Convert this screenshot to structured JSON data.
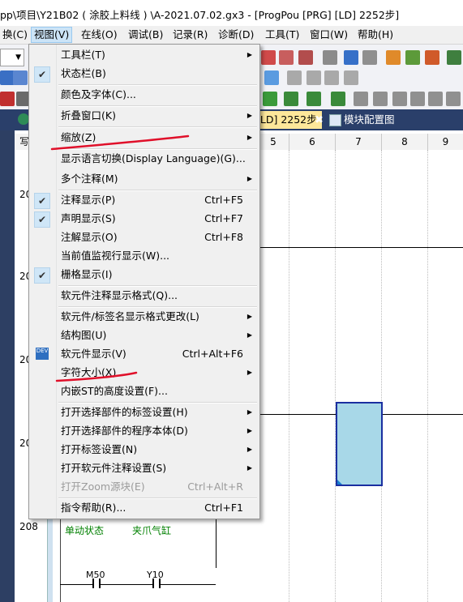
{
  "window": {
    "title": "pp\\项目\\Y21B02 ( 涂胶上料线 ) \\A-2021.07.02.gx3 - [ProgPou [PRG] [LD] 2252步]"
  },
  "menubar": {
    "items": [
      {
        "label": "换(C)"
      },
      {
        "label": "视图(V)"
      },
      {
        "label": "在线(O)"
      },
      {
        "label": "调试(B)"
      },
      {
        "label": "记录(R)"
      },
      {
        "label": "诊断(D)"
      },
      {
        "label": "工具(T)"
      },
      {
        "label": "窗口(W)"
      },
      {
        "label": "帮助(H)"
      }
    ]
  },
  "tabs": [
    {
      "label": "[LD] 2252步"
    },
    {
      "label": "模块配置图"
    }
  ],
  "ladder": {
    "columns": [
      "写",
      "5",
      "6",
      "7",
      "8",
      "9"
    ],
    "row_numbers": [
      "20",
      "20",
      "20",
      "20",
      "208"
    ],
    "comments": {
      "c1": "单动状态",
      "c2": "夹爪气缸"
    },
    "contacts": {
      "m50": "M50",
      "y10": "Y10"
    }
  },
  "dropdown": {
    "items": [
      {
        "label": "工具栏(T)",
        "has_submenu": true
      },
      {
        "label": "状态栏(B)",
        "checked": true
      },
      {
        "label": "颜色及字体(C)..."
      },
      {
        "label": "折叠窗口(K)",
        "has_submenu": true
      },
      {
        "label": "缩放(Z)",
        "has_submenu": true
      },
      {
        "label": "显示语言切换(Display Language)(G)..."
      },
      {
        "label": "多个注释(M)",
        "has_submenu": true
      },
      {
        "label": "注释显示(P)",
        "shortcut": "Ctrl+F5",
        "checked": true
      },
      {
        "label": "声明显示(S)",
        "shortcut": "Ctrl+F7",
        "checked": true
      },
      {
        "label": "注解显示(O)",
        "shortcut": "Ctrl+F8"
      },
      {
        "label": "当前值监视行显示(W)..."
      },
      {
        "label": "栅格显示(I)",
        "checked": true
      },
      {
        "label": "软元件注释显示格式(Q)..."
      },
      {
        "label": "软元件/标签名显示格式更改(L)",
        "has_submenu": true
      },
      {
        "label": "结构图(U)",
        "has_submenu": true
      },
      {
        "label": "软元件显示(V)",
        "shortcut": "Ctrl+Alt+F6",
        "icon": "dev-icon"
      },
      {
        "label": "字符大小(X)",
        "has_submenu": true
      },
      {
        "label": "内嵌ST的高度设置(F)..."
      },
      {
        "label": "打开选择部件的标签设置(H)",
        "has_submenu": true
      },
      {
        "label": "打开选择部件的程序本体(D)",
        "has_submenu": true
      },
      {
        "label": "打开标签设置(N)",
        "has_submenu": true
      },
      {
        "label": "打开软元件注释设置(S)",
        "has_submenu": true
      },
      {
        "label": "打开Zoom源块(E)",
        "shortcut": "Ctrl+Alt+R",
        "disabled": true
      },
      {
        "label": "指令帮助(R)...",
        "shortcut": "Ctrl+F1"
      }
    ]
  },
  "colors": {
    "annotation_red": "#e0102a",
    "selection_fill": "#a8d8e8",
    "selection_border": "#1a2fa0",
    "comment_green": "#008000"
  }
}
